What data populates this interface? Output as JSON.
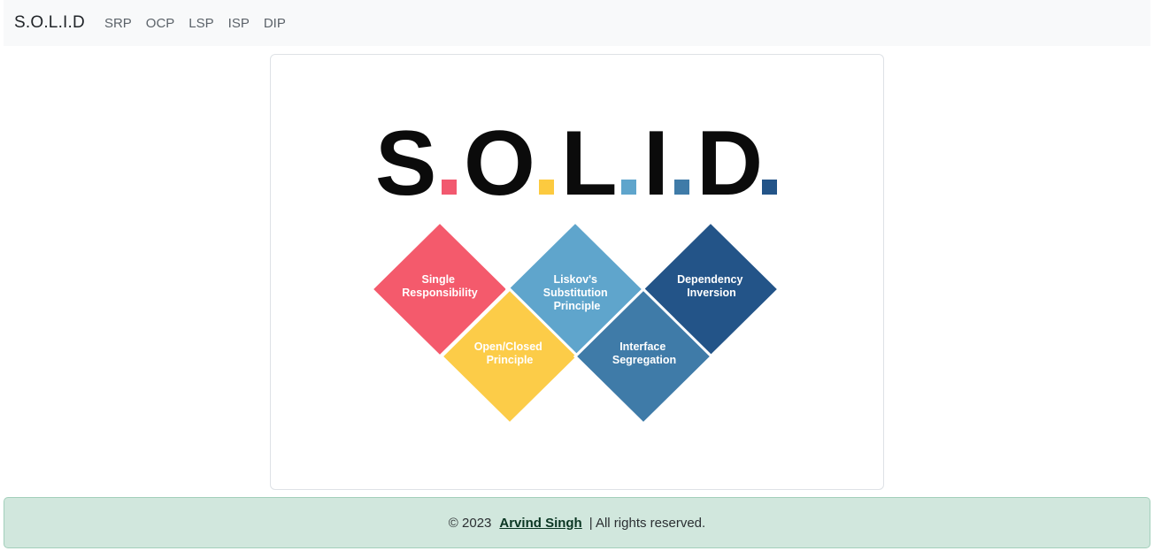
{
  "navbar": {
    "brand": "S.O.L.I.D",
    "links": [
      "SRP",
      "OCP",
      "LSP",
      "ISP",
      "DIP"
    ]
  },
  "logo": {
    "letters": [
      "S",
      "O",
      "L",
      "I",
      "D"
    ],
    "dot_colors": [
      "#f2596f",
      "#fcca3f",
      "#5fa5cc",
      "#3f7ba8",
      "#235488"
    ]
  },
  "principles": [
    {
      "lines": [
        "Single",
        "Responsibility"
      ],
      "color": "#f45a6c"
    },
    {
      "lines": [
        "Open/Closed",
        "Principle"
      ],
      "color": "#fccc48"
    },
    {
      "lines": [
        "Liskov's",
        "Substitution",
        "Principle"
      ],
      "color": "#5fa5cc"
    },
    {
      "lines": [
        "Interface",
        "Segregation"
      ],
      "color": "#3f7ba8"
    },
    {
      "lines": [
        "Dependency",
        "Inversion"
      ],
      "color": "#235488"
    }
  ],
  "footer": {
    "copyright": "© 2023",
    "author": "Arvind Singh",
    "rights": "| All rights reserved."
  }
}
